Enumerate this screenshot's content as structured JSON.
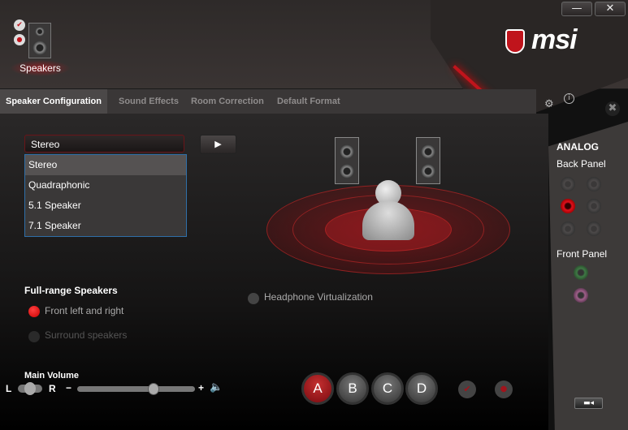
{
  "header": {
    "device_label": "Speakers",
    "brand": "msi",
    "minimize": "—",
    "close": "✕"
  },
  "tabs": [
    {
      "label": "Speaker Configuration",
      "active": true
    },
    {
      "label": "Sound Effects"
    },
    {
      "label": "Room Correction"
    },
    {
      "label": "Default Format"
    }
  ],
  "config": {
    "selected": "Stereo",
    "options": [
      "Stereo",
      "Quadraphonic",
      "5.1 Speaker",
      "7.1 Speaker"
    ],
    "play": "▶"
  },
  "fullrange": {
    "title": "Full-range Speakers",
    "front": "Front left and right",
    "front_checked": true,
    "surround": "Surround speakers",
    "surround_checked": false
  },
  "headphone": {
    "label": "Headphone Virtualization",
    "checked": false
  },
  "volume": {
    "title": "Main Volume",
    "left": "L",
    "right": "R",
    "minus": "−",
    "plus": "+",
    "level_percent": 65,
    "balance": 0
  },
  "profiles": {
    "items": [
      "A",
      "B",
      "C",
      "D"
    ],
    "active": "A"
  },
  "right_panel": {
    "title": "ANALOG",
    "back": "Back Panel",
    "front": "Front Panel"
  },
  "colors": {
    "accent": "#c0141c",
    "jack_active": "#e0101c",
    "jack_green": "#3f7a45",
    "jack_pink": "#a0608a"
  }
}
